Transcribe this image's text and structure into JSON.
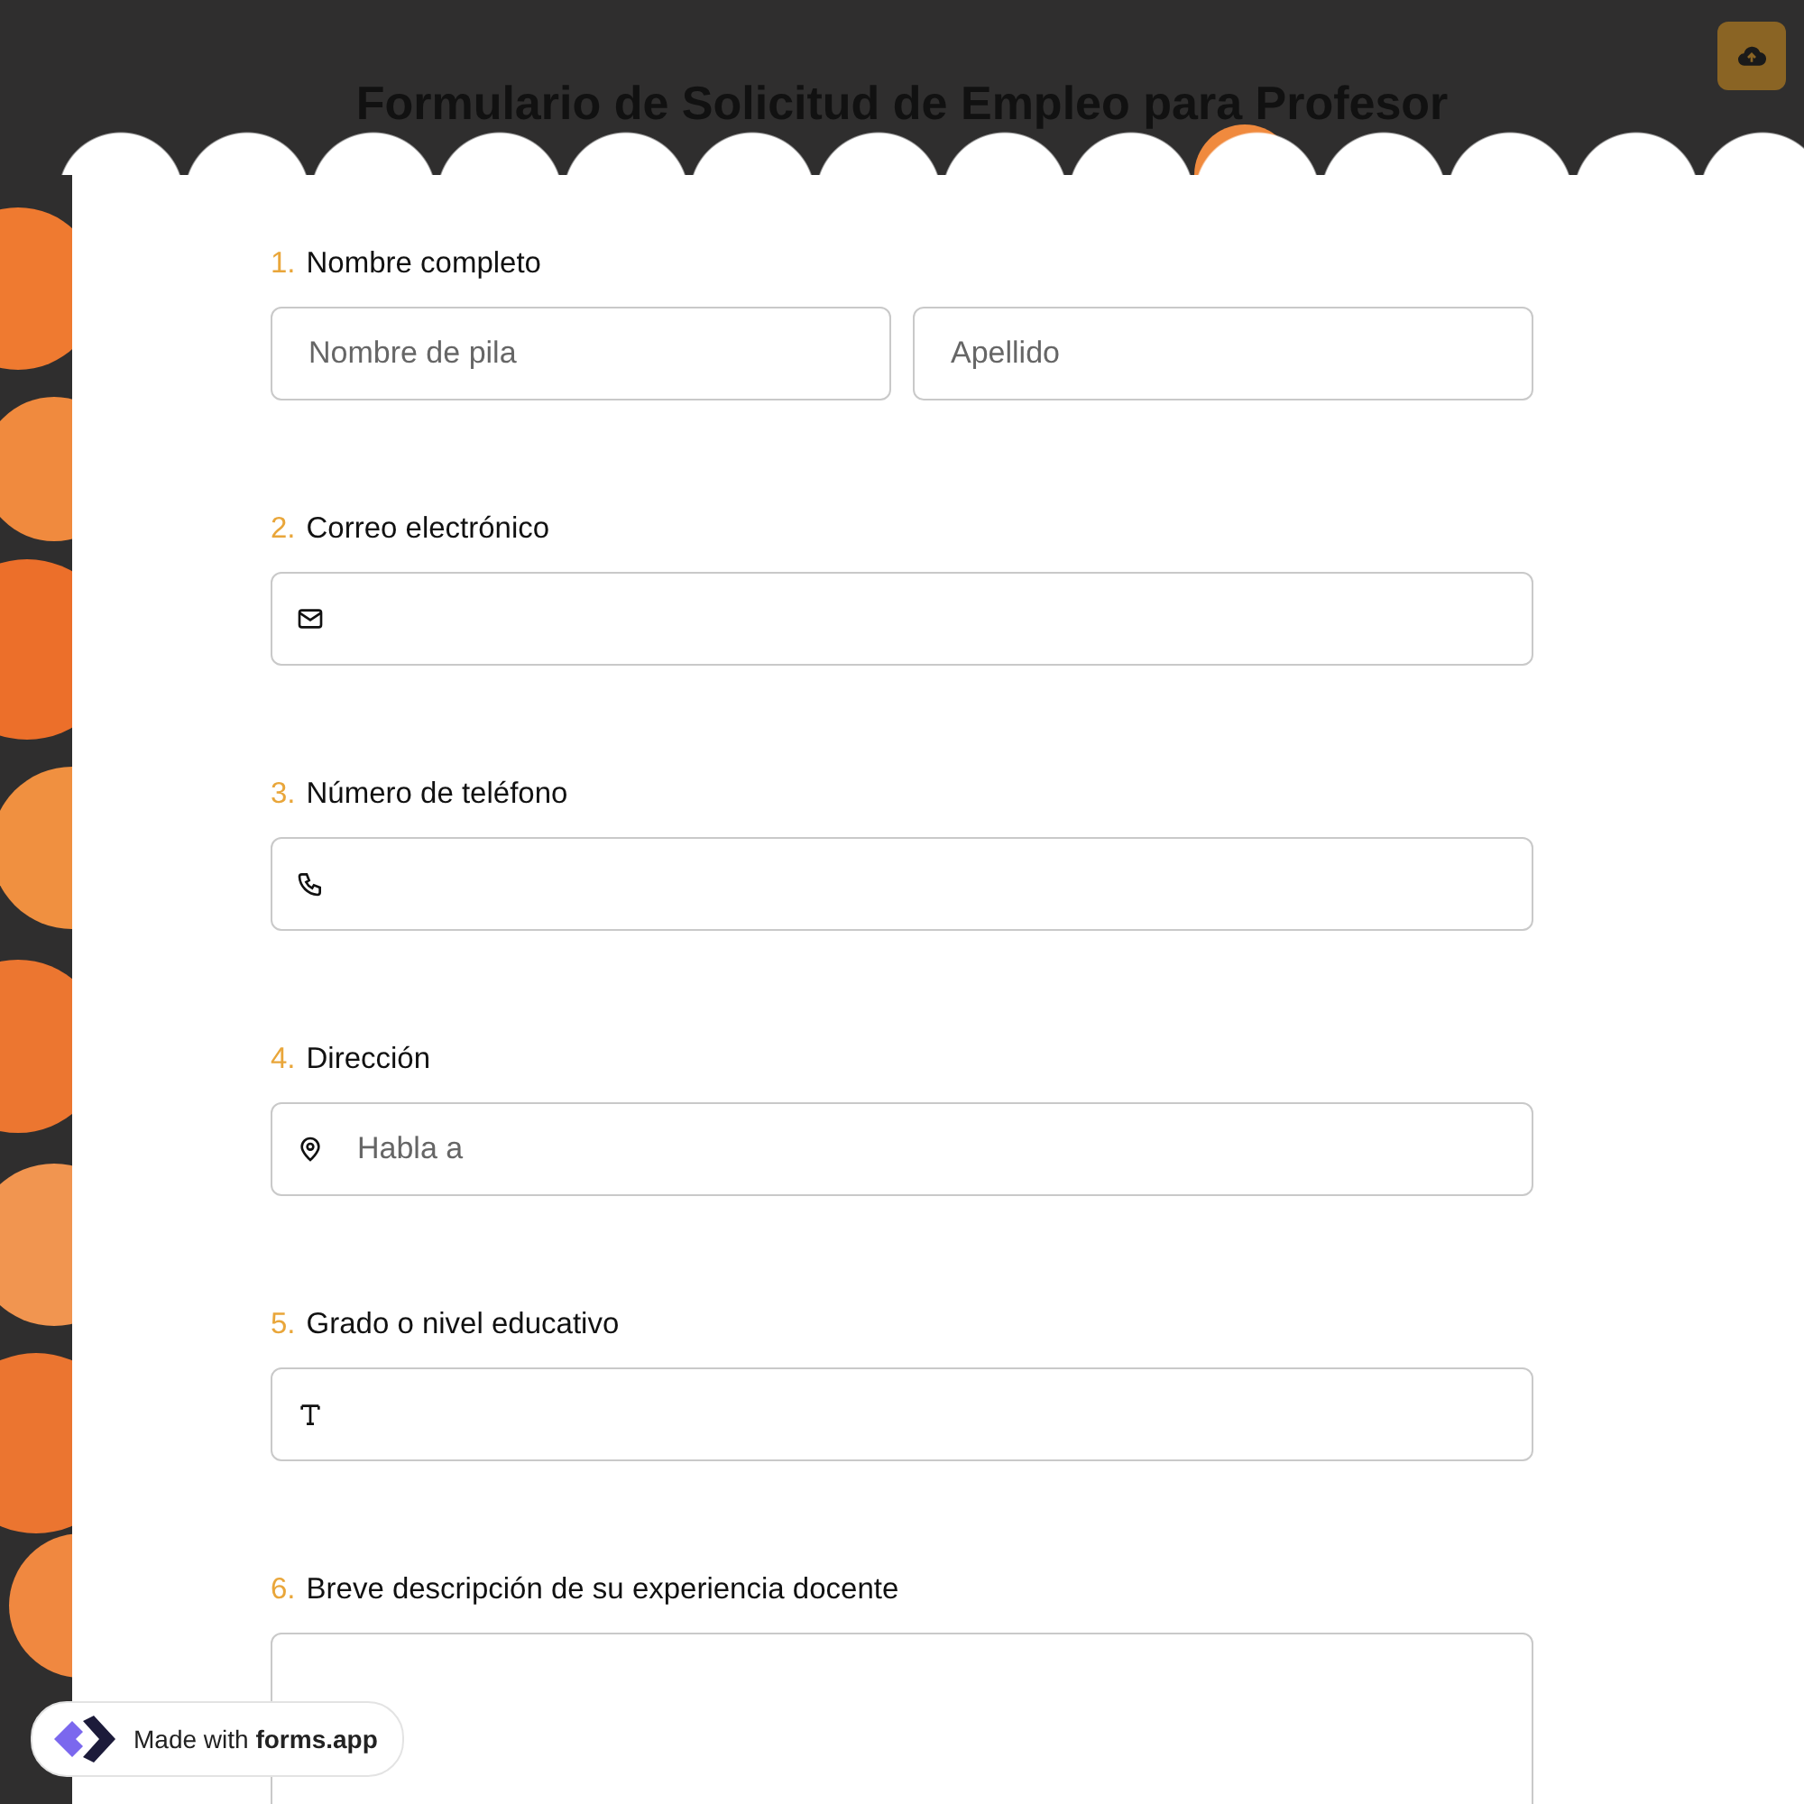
{
  "title": "Formulario de Solicitud de Empleo para Profesor",
  "questions": [
    {
      "number": "1.",
      "label": "Nombre completo",
      "fields": [
        {
          "kind": "text",
          "placeholder": "Nombre de pila"
        },
        {
          "kind": "text",
          "placeholder": "Apellido"
        }
      ]
    },
    {
      "number": "2.",
      "label": "Correo electrónico",
      "fields": [
        {
          "kind": "email"
        }
      ]
    },
    {
      "number": "3.",
      "label": "Número de teléfono",
      "fields": [
        {
          "kind": "phone"
        }
      ]
    },
    {
      "number": "4.",
      "label": "Dirección",
      "fields": [
        {
          "kind": "address",
          "placeholder": "Habla a"
        }
      ]
    },
    {
      "number": "5.",
      "label": "Grado o nivel educativo",
      "fields": [
        {
          "kind": "short_text"
        }
      ]
    },
    {
      "number": "6.",
      "label": "Breve descripción de su experiencia docente",
      "fields": [
        {
          "kind": "long_text"
        }
      ]
    }
  ],
  "badge": "Made with **forms.app**"
}
